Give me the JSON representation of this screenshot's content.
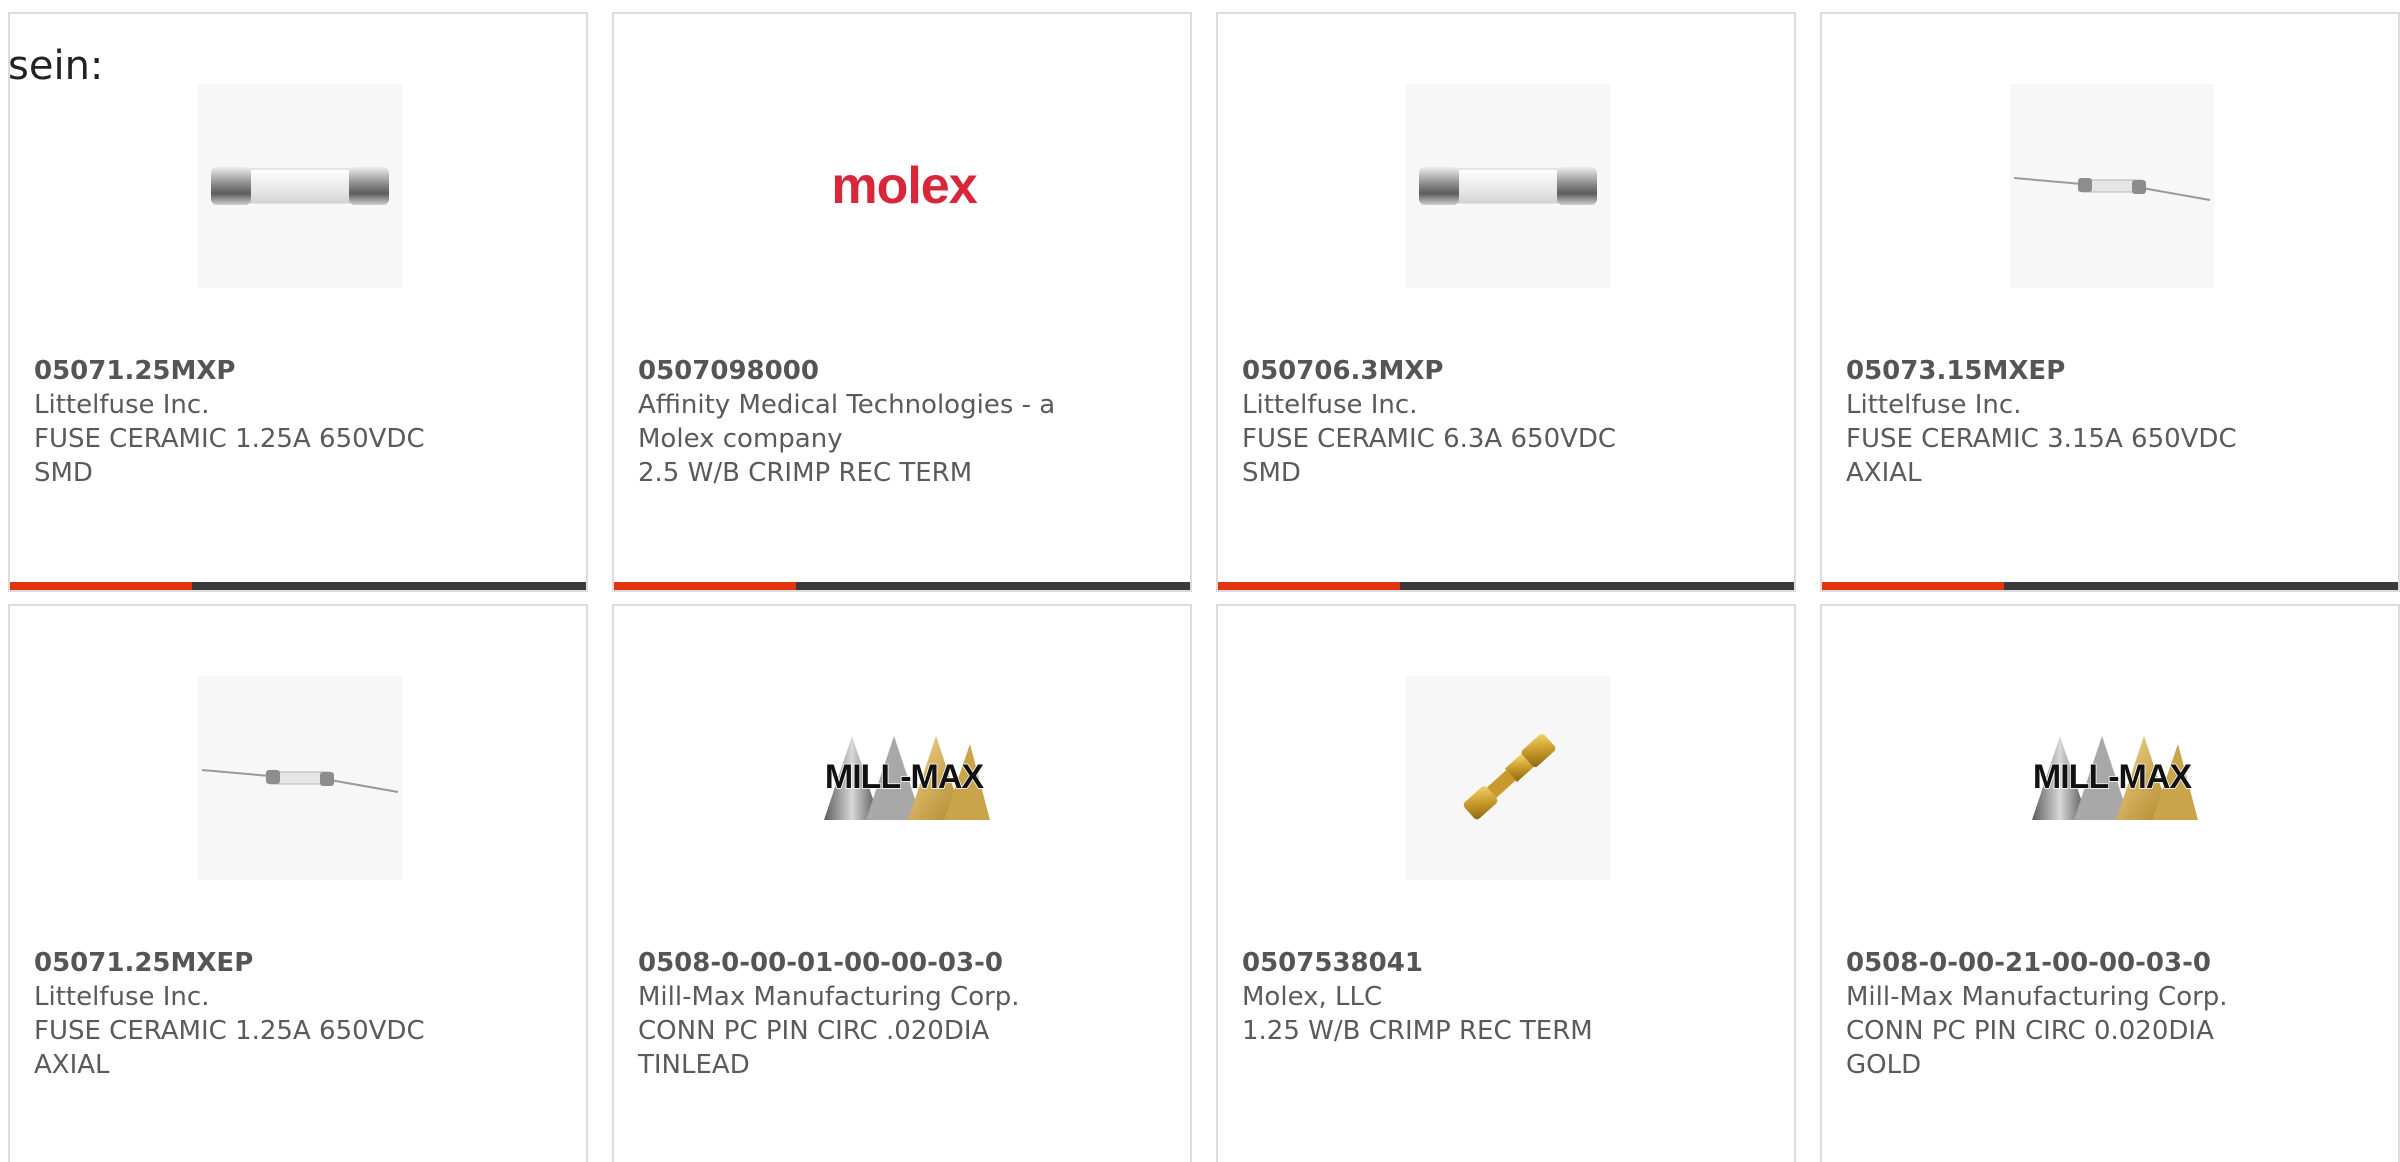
{
  "intro": {
    "text": "sein:"
  },
  "products": [
    {
      "part_number": "05071.25MXP",
      "manufacturer": "Littelfuse Inc.",
      "description_lines": [
        "FUSE CERAMIC 1.25A 650VDC",
        "SMD"
      ],
      "image_icon": "cartridge-fuse-icon",
      "has_bar": true
    },
    {
      "part_number": "0507098000",
      "manufacturer_lines": [
        "Affinity Medical Technologies - a",
        "Molex company"
      ],
      "description_lines": [
        "2.5 W/B CRIMP REC TERM"
      ],
      "image_icon": "molex-logo",
      "logo_text": "molex",
      "has_bar": true
    },
    {
      "part_number": "050706.3MXP",
      "manufacturer": "Littelfuse Inc.",
      "description_lines": [
        "FUSE CERAMIC 6.3A 650VDC",
        "SMD"
      ],
      "image_icon": "cartridge-fuse-icon",
      "has_bar": true
    },
    {
      "part_number": "05073.15MXEP",
      "manufacturer": "Littelfuse Inc.",
      "description_lines": [
        "FUSE CERAMIC 3.15A 650VDC",
        "AXIAL"
      ],
      "image_icon": "axial-fuse-icon",
      "has_bar": true
    },
    {
      "part_number": "05071.25MXEP",
      "manufacturer": "Littelfuse Inc.",
      "description_lines": [
        "FUSE CERAMIC 1.25A 650VDC",
        "AXIAL"
      ],
      "image_icon": "axial-fuse-icon",
      "has_bar": false
    },
    {
      "part_number": "0508-0-00-01-00-00-03-0",
      "manufacturer": "Mill-Max Manufacturing Corp.",
      "description_lines": [
        "CONN PC PIN CIRC .020DIA",
        "TINLEAD"
      ],
      "image_icon": "mill-max-logo",
      "logo_text": "MILL-MAX",
      "has_bar": false
    },
    {
      "part_number": "0507538041",
      "manufacturer": "Molex, LLC",
      "description_lines": [
        "1.25 W/B CRIMP REC TERM"
      ],
      "image_icon": "crimp-terminal-icon",
      "has_bar": false
    },
    {
      "part_number": "0508-0-00-21-00-00-03-0",
      "manufacturer": "Mill-Max Manufacturing Corp.",
      "description_lines": [
        "CONN PC PIN CIRC 0.020DIA",
        "GOLD"
      ],
      "image_icon": "mill-max-logo",
      "logo_text": "MILL-MAX",
      "has_bar": false
    }
  ],
  "colors": {
    "accent": "#e2350f",
    "bar": "#3a3a3a",
    "border": "#dcdcdc",
    "text": "#5a5a5a"
  }
}
